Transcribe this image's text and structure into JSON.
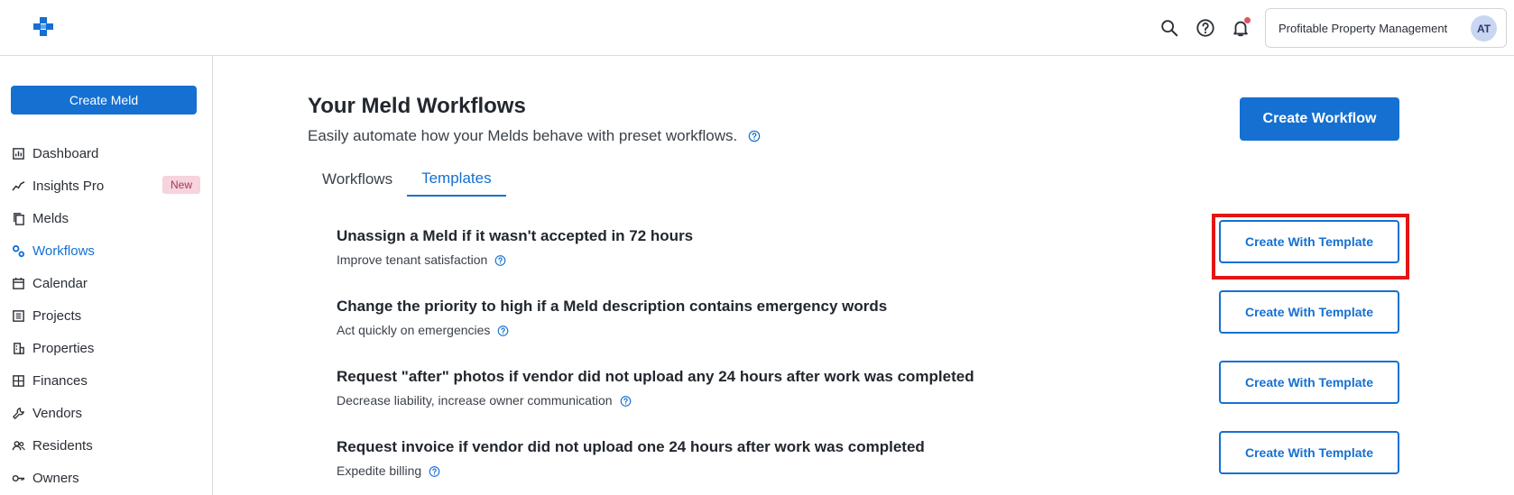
{
  "header": {
    "logo_icon": "meld-logo-icon",
    "icons": [
      "search-icon",
      "help-icon",
      "bell-icon"
    ],
    "account_name": "Profitable Property Management",
    "avatar_initials": "AT"
  },
  "sidebar": {
    "create_label": "Create Meld",
    "items": [
      {
        "label": "Dashboard",
        "icon": "dashboard-icon"
      },
      {
        "label": "Insights Pro",
        "icon": "insights-icon",
        "badge": "New"
      },
      {
        "label": "Melds",
        "icon": "melds-icon"
      },
      {
        "label": "Workflows",
        "icon": "workflows-icon",
        "active": true
      },
      {
        "label": "Calendar",
        "icon": "calendar-icon"
      },
      {
        "label": "Projects",
        "icon": "projects-icon"
      },
      {
        "label": "Properties",
        "icon": "properties-icon"
      },
      {
        "label": "Finances",
        "icon": "finances-icon"
      },
      {
        "label": "Vendors",
        "icon": "vendors-icon"
      },
      {
        "label": "Residents",
        "icon": "residents-icon"
      },
      {
        "label": "Owners",
        "icon": "owners-icon"
      }
    ]
  },
  "main": {
    "title": "Your Meld Workflows",
    "subtitle": "Easily automate how your Melds behave with preset workflows.",
    "create_workflow_label": "Create Workflow",
    "tabs": [
      {
        "label": "Workflows",
        "active": false
      },
      {
        "label": "Templates",
        "active": true
      }
    ],
    "templates": [
      {
        "title": "Unassign a Meld if it wasn't accepted in 72 hours",
        "description": "Improve tenant satisfaction",
        "button": "Create With Template"
      },
      {
        "title": "Change the priority to high if a Meld description contains emergency words",
        "description": "Act quickly on emergencies",
        "button": "Create With Template"
      },
      {
        "title": "Request \"after\" photos if vendor did not upload any 24 hours after work was completed",
        "description": "Decrease liability, increase owner communication",
        "button": "Create With Template"
      },
      {
        "title": "Request invoice if vendor did not upload one 24 hours after work was completed",
        "description": "Expedite billing",
        "button": "Create With Template"
      }
    ]
  },
  "colors": {
    "accent": "#1570d2",
    "highlight": "#e31515",
    "badge_bg": "#f6d3dd",
    "notification_dot": "#e0535e"
  }
}
